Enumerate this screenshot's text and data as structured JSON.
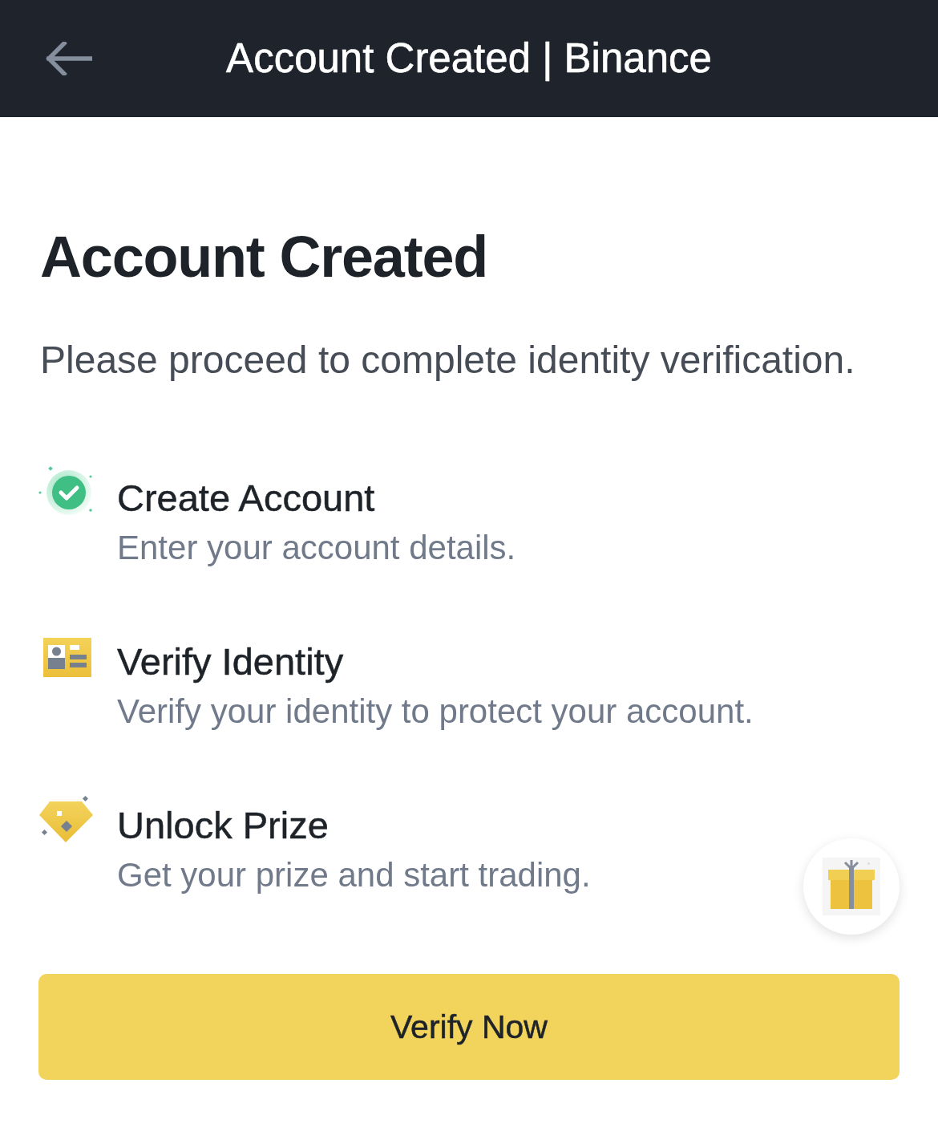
{
  "header": {
    "title": "Account Created | Binance"
  },
  "heading": "Account Created",
  "subtitle": "Please proceed to complete identity verification.",
  "steps": [
    {
      "title": "Create Account",
      "description": "Enter your account details.",
      "completed": true
    },
    {
      "title": "Verify Identity",
      "description": "Verify your identity to protect your account.",
      "completed": false
    },
    {
      "title": "Unlock Prize",
      "description": "Get your prize and start trading.",
      "completed": false
    }
  ],
  "primary_button": {
    "label": "Verify Now"
  }
}
